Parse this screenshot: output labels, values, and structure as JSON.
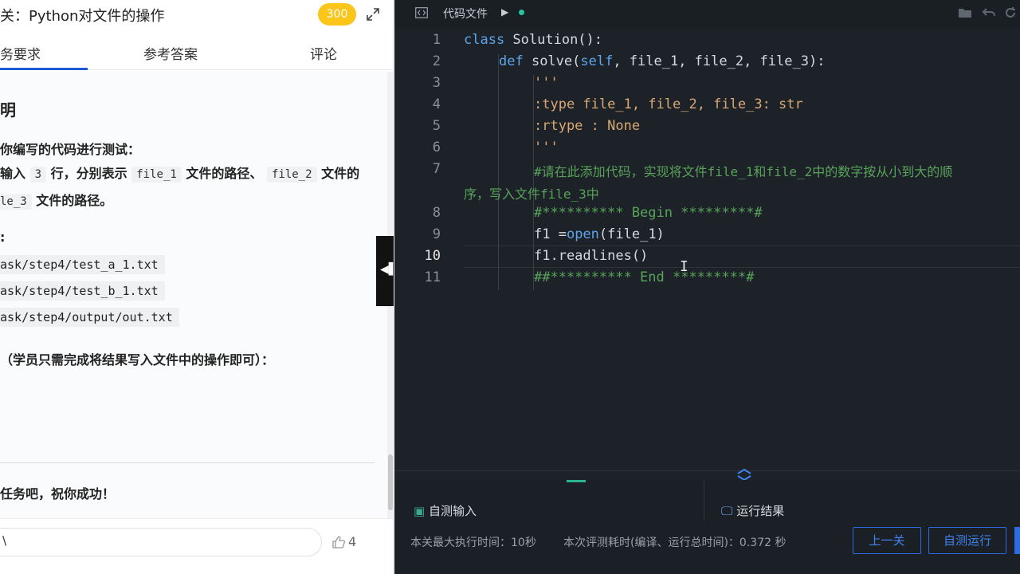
{
  "header": {
    "title": "关：Python对文件的操作",
    "score": "300"
  },
  "tabs": {
    "task": "务要求",
    "answer": "参考答案",
    "comment": "评论"
  },
  "content": {
    "heading": "明",
    "line1": "你编写的代码进行测试：",
    "line2_a": "输入",
    "line2_num": "3",
    "line2_b": "行，分别表示",
    "line2_code1": "file_1",
    "line2_c": "文件的路径、",
    "line2_code2": "file_2",
    "line2_d": "文件的",
    "line3_code": "le_3",
    "line3_a": "文件的路径。",
    "colon": ":",
    "paths": [
      "ask/step4/test_a_1.txt",
      "ask/step4/test_b_1.txt",
      "ask/step4/output/out.txt"
    ],
    "output_note": "（学员只需完成将结果写入文件中的操作即可）：",
    "footer_text": "任务吧，祝你成功！"
  },
  "comment_bar": {
    "input_value": "\\",
    "like_count": "4"
  },
  "editor": {
    "file_tab": "代码文件",
    "lines": [
      {
        "n": "1"
      },
      {
        "n": "2"
      },
      {
        "n": "3"
      },
      {
        "n": "4"
      },
      {
        "n": "5"
      },
      {
        "n": "6"
      },
      {
        "n": "7"
      },
      {
        "n": "8"
      },
      {
        "n": "9"
      },
      {
        "n": "10"
      },
      {
        "n": "11"
      }
    ],
    "code": {
      "l1_kw": "class",
      "l1_rest": " Solution():",
      "l2_kw": "def",
      "l2_name": " solve(",
      "l2_self": "self",
      "l2_rest": ", file_1, file_2, file_3):",
      "l3": "'''",
      "l4": ":type file_1, file_2, file_3: str",
      "l5": ":rtype : None",
      "l6": "'''",
      "l7a": "#请在此添加代码，实现将文件file_1和file_2中的数字按从小到大的顺",
      "l7b": "序，写入文件file_3中",
      "l8": "#********** Begin *********#",
      "l9_a": "f1 =",
      "l9_open": "open",
      "l9_b": "(file_1)",
      "l10": "f1.readlines()",
      "l11": "##********** End *********#"
    }
  },
  "bottom": {
    "self_input": "自测输入",
    "run_result": "运行结果",
    "max_time": "本关最大执行时间：10秒",
    "eval_time": "本次评测耗时(编译、运行总时间)：0.372 秒",
    "btn_prev": "上一关",
    "btn_selftest": "自测运行"
  },
  "colors": {
    "accent_blue": "#2d6be0",
    "badge_yellow": "#fbc51a",
    "editor_bg": "#1d2228",
    "keyword": "#5da4ec",
    "comment": "#58a35a",
    "string": "#d9a873"
  }
}
